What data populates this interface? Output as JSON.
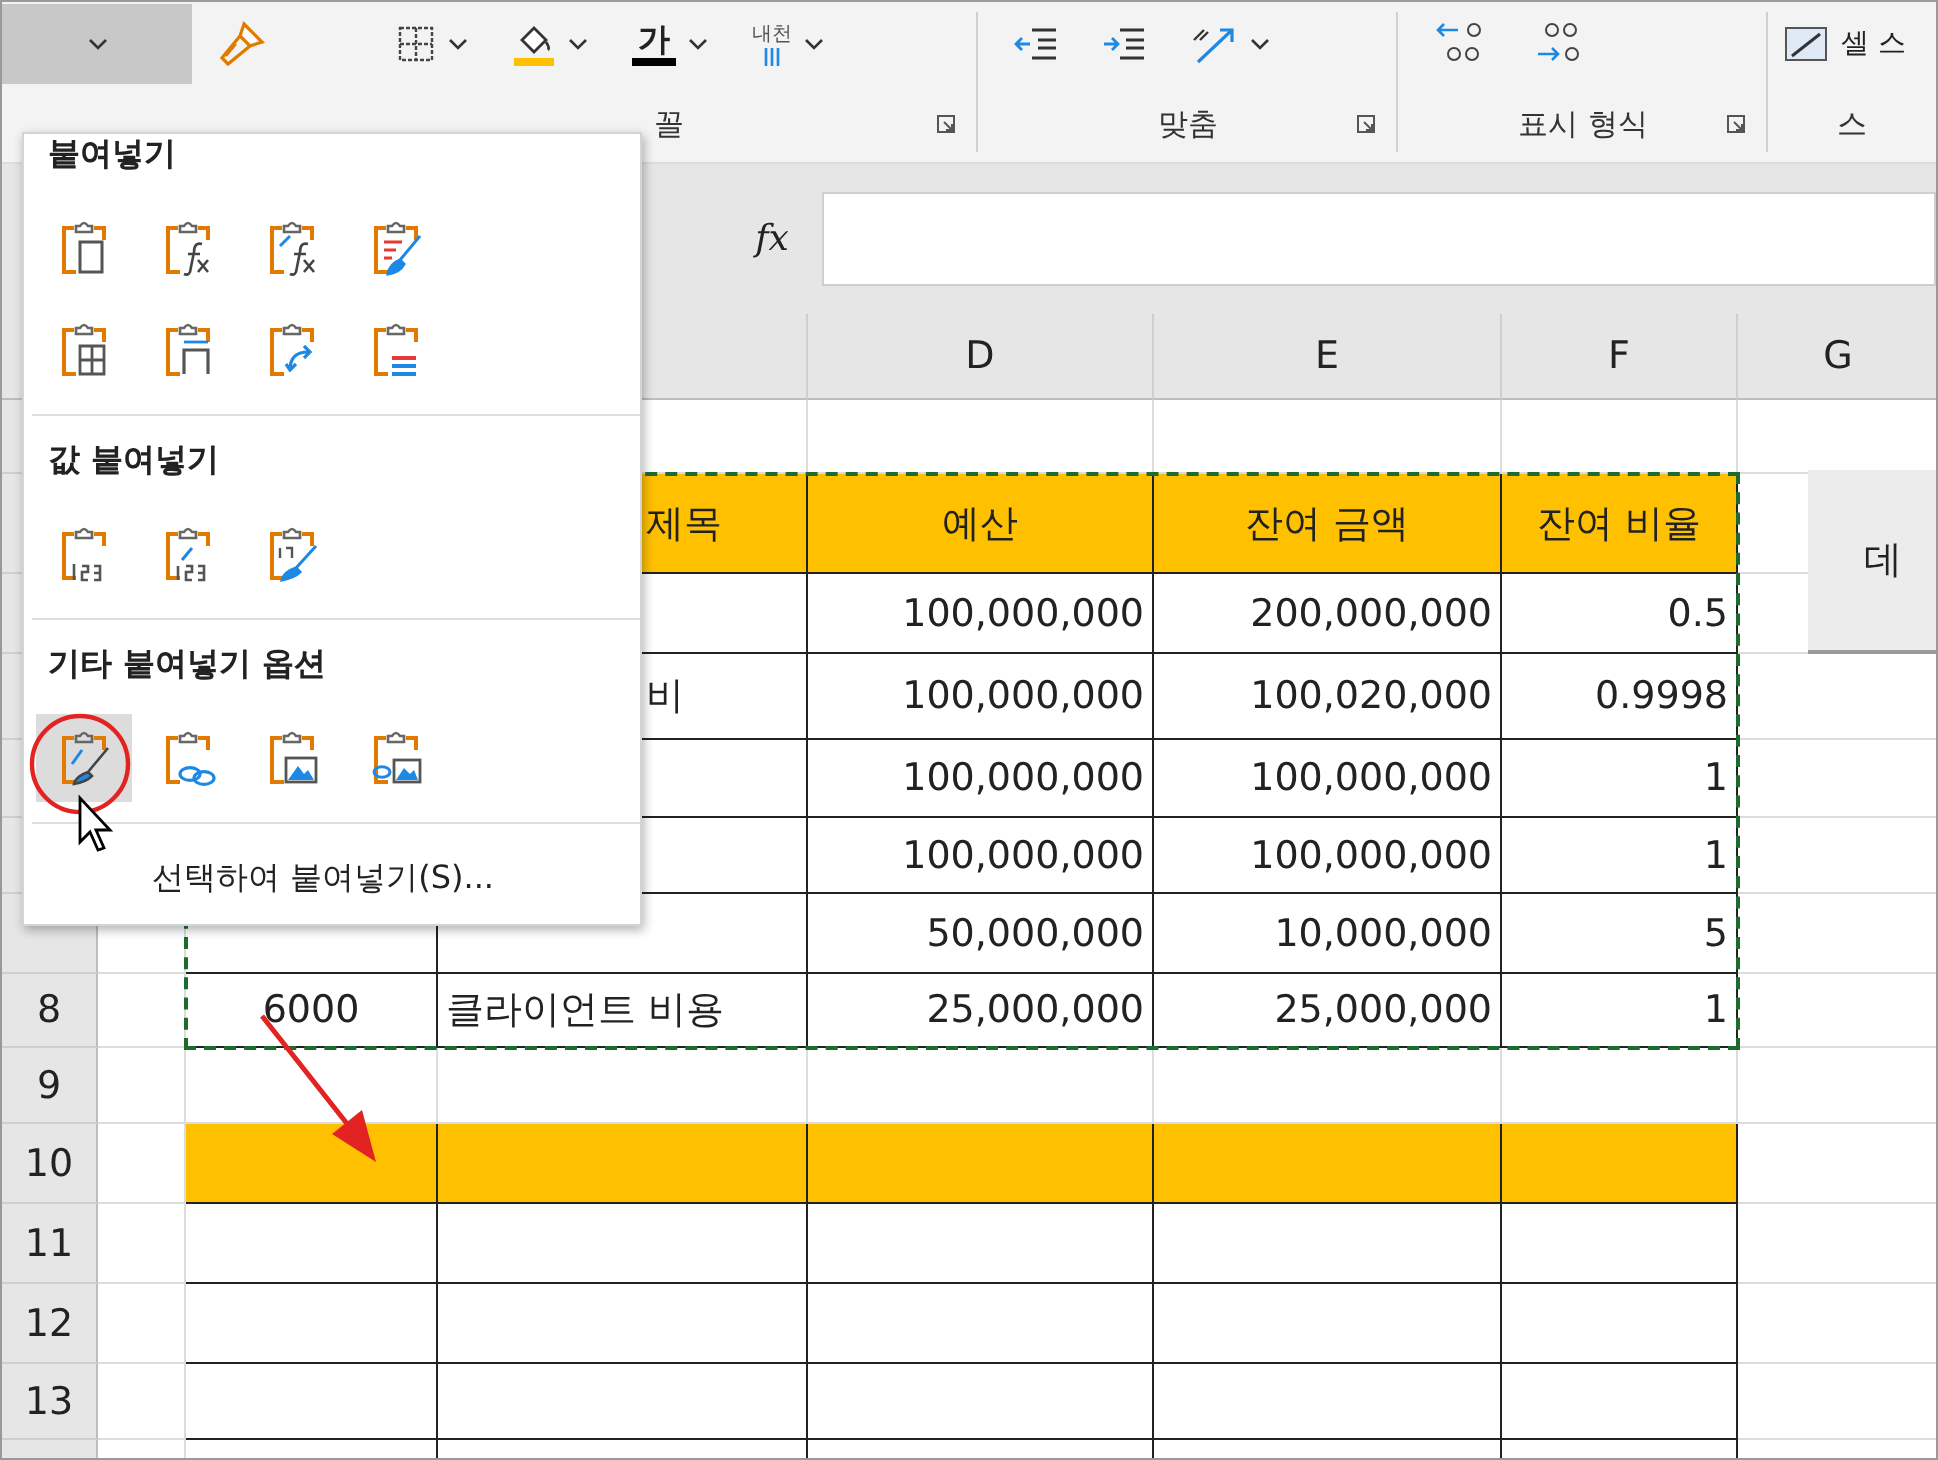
{
  "ribbon": {
    "paste_dropdown": {
      "pressed": true
    },
    "font_color_glyph": "가",
    "phonetic_label": "내천",
    "groups": [
      {
        "label": "꼴"
      },
      {
        "label": "맞춤"
      },
      {
        "label": "표시 형식"
      },
      {
        "label": "스"
      }
    ],
    "cell_styles_label": "셀 스"
  },
  "formula_bar": {
    "function_label": "fx"
  },
  "columns": [
    null,
    null,
    null,
    "D",
    "E",
    "F",
    "G"
  ],
  "rows": [
    {
      "kind": "plain",
      "cells": [
        null,
        null,
        null,
        null,
        null,
        null,
        null
      ]
    },
    {
      "kind": "header",
      "cells": [
        null,
        null,
        "제목",
        "예산",
        "잔여 금액",
        "잔여 비율",
        null
      ]
    },
    {
      "kind": "data",
      "cells": [
        null,
        null,
        null,
        "100,000,000",
        "200,000,000",
        "0.5",
        null
      ]
    },
    {
      "kind": "data",
      "cells": [
        null,
        null,
        "비",
        "100,000,000",
        "100,020,000",
        "0.9998",
        null
      ]
    },
    {
      "kind": "data",
      "cells": [
        null,
        null,
        null,
        "100,000,000",
        "100,000,000",
        "1",
        null
      ]
    },
    {
      "kind": "data",
      "cells": [
        null,
        null,
        null,
        "100,000,000",
        "100,000,000",
        "1",
        null
      ]
    },
    {
      "kind": "data",
      "cells": [
        null,
        null,
        null,
        "50,000,000",
        "10,000,000",
        "5",
        null
      ]
    },
    {
      "kind": "data",
      "number": "8",
      "cells": [
        null,
        "6000",
        "클라이언트 비용",
        "25,000,000",
        "25,000,000",
        "1",
        null
      ]
    },
    {
      "kind": "plain",
      "number": "9",
      "cells": [
        null,
        null,
        null,
        null,
        null,
        null,
        null
      ]
    },
    {
      "kind": "fill",
      "number": "10",
      "cells": [
        null,
        null,
        null,
        null,
        null,
        null,
        null
      ]
    },
    {
      "kind": "data",
      "number": "11",
      "cells": [
        null,
        null,
        null,
        null,
        null,
        null,
        null
      ]
    },
    {
      "kind": "data",
      "number": "12",
      "cells": [
        null,
        null,
        null,
        null,
        null,
        null,
        null
      ]
    },
    {
      "kind": "data",
      "number": "13",
      "cells": [
        null,
        null,
        null,
        null,
        null,
        null,
        null
      ]
    },
    {
      "kind": "data",
      "cells": [
        null,
        null,
        null,
        null,
        null,
        null,
        null
      ]
    }
  ],
  "floating_button": {
    "label": "데"
  },
  "paste_menu": {
    "sections": [
      {
        "title": "붙여넣기",
        "options": [
          {
            "kind": "paste",
            "selected": false
          },
          {
            "kind": "formulas",
            "selected": false
          },
          {
            "kind": "formulas-number",
            "selected": false
          },
          {
            "kind": "keep-source",
            "selected": false
          },
          {
            "kind": "no-borders",
            "selected": false
          },
          {
            "kind": "column-widths",
            "selected": false
          },
          {
            "kind": "transpose",
            "selected": false
          },
          {
            "kind": "merge-format",
            "selected": false
          }
        ]
      },
      {
        "title": "값 붙여넣기",
        "options": [
          {
            "kind": "values",
            "selected": false
          },
          {
            "kind": "values-number",
            "selected": false
          },
          {
            "kind": "values-source",
            "selected": false
          }
        ]
      },
      {
        "title": "기타 붙여넣기 옵션",
        "options": [
          {
            "kind": "formatting",
            "selected": true
          },
          {
            "kind": "link",
            "selected": false
          },
          {
            "kind": "picture",
            "selected": false
          },
          {
            "kind": "linked-picture",
            "selected": false
          }
        ]
      }
    ],
    "footer": "선택하여 붙여넣기(S)..."
  }
}
